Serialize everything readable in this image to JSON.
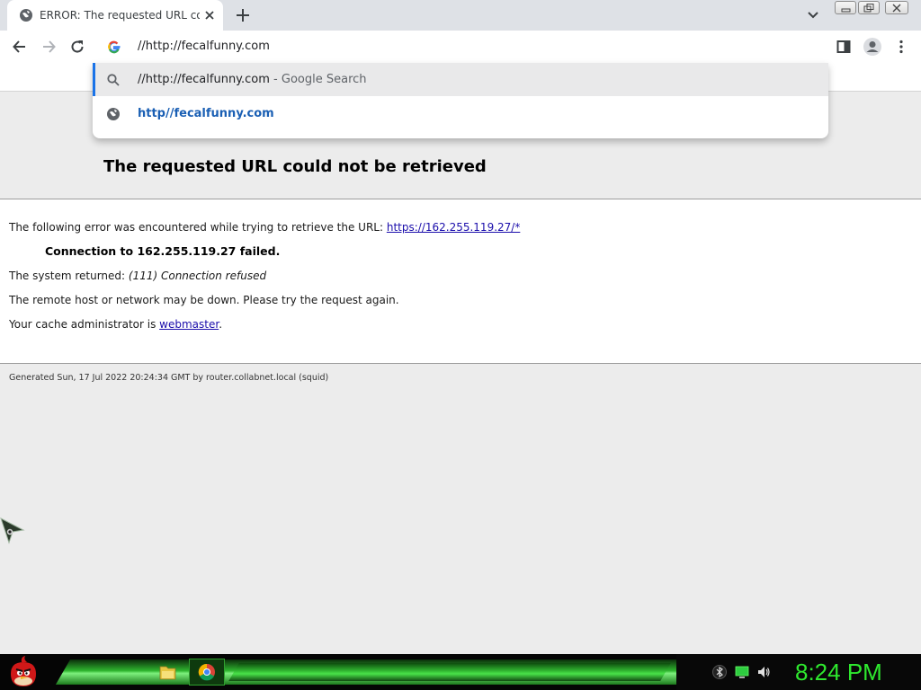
{
  "browser": {
    "tab": {
      "title": "ERROR: The requested URL could not be retrieved",
      "favicon": "globe-icon",
      "close_icon": "close-icon"
    },
    "new_tab_icon": "plus-icon",
    "tab_search_icon": "chevron-down-icon",
    "window_controls": [
      "minimize-icon",
      "restore-icon",
      "close-icon"
    ],
    "nav": {
      "back_icon": "arrow-left-icon",
      "forward_icon": "arrow-right-icon",
      "reload_icon": "reload-icon"
    },
    "omnibox": {
      "engine_icon": "google-icon",
      "value": "//http://fecalfunny.com"
    },
    "suggestions": [
      {
        "icon": "search-icon",
        "text": "//http://fecalfunny.com",
        "suffix": " - Google Search",
        "selected": true
      },
      {
        "icon": "globe-icon",
        "text": "http//fecalfunny.com",
        "selected": false
      }
    ],
    "toolbar_right": [
      "side-panel-icon",
      "profile-icon",
      "kebab-menu-icon"
    ]
  },
  "page": {
    "title": "The requested URL could not be retrieved",
    "intro": "The following error was encountered while trying to retrieve the URL: ",
    "url_link": "https://162.255.119.27/*",
    "connection_failed": "Connection to 162.255.119.27 failed.",
    "system_returned_label": "The system returned: ",
    "system_returned_value": "(111) Connection refused",
    "remote_host_msg": "The remote host or network may be down. Please try the request again.",
    "cache_admin_label": "Your cache administrator is ",
    "cache_admin_link": "webmaster",
    "cache_admin_end": ".",
    "generated": "Generated Sun, 17 Jul 2022 20:24:34 GMT by router.collabnet.local (squid)"
  },
  "taskbar": {
    "start_icon": "angry-bird-icon",
    "apps": [
      "file-manager-icon",
      "chrome-icon"
    ],
    "tray": [
      "bluetooth-icon",
      "network-icon",
      "volume-icon"
    ],
    "clock": "8:24 PM",
    "clock_color": "#2ee82e"
  },
  "colors": {
    "accent": "#1a73e8",
    "link": "#1a0dab",
    "page_bg": "#ececec"
  }
}
